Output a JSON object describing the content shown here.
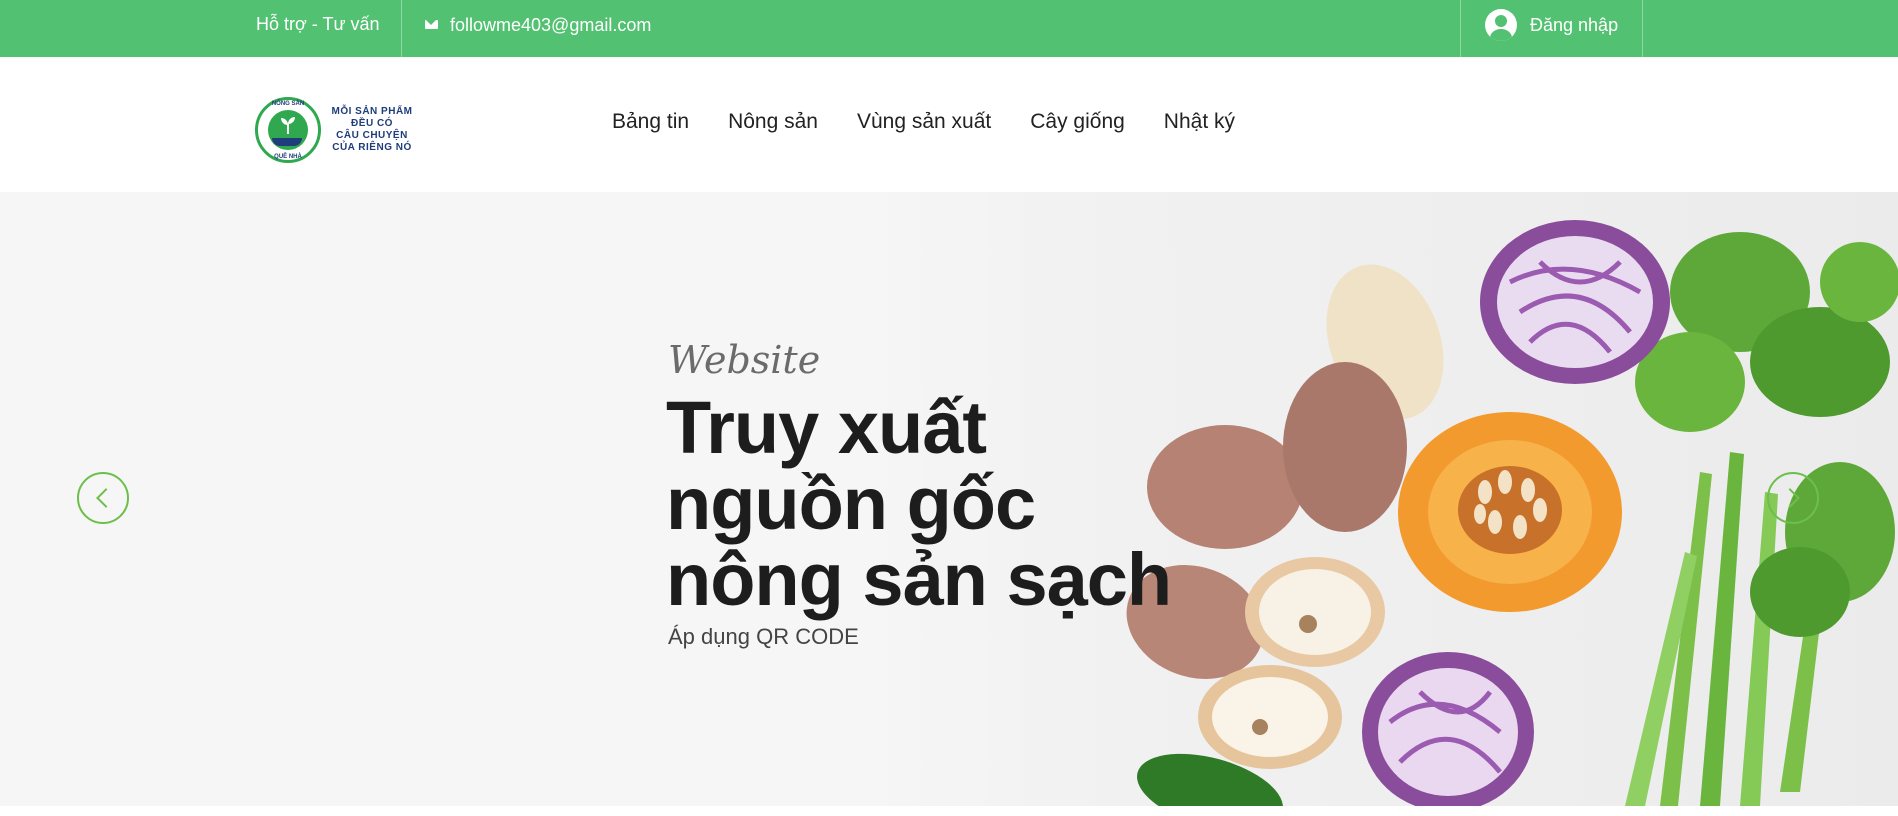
{
  "topbar": {
    "support": "Hỗ trợ - Tư vấn",
    "email": "followme403@gmail.com",
    "login": "Đăng nhập",
    "bg_color": "#53c172"
  },
  "logo": {
    "ring_top": "NÔNG SẢN",
    "ring_bottom": "QUÊ NHÀ",
    "slogan_line1": "MỖI SẢN PHẨM",
    "slogan_line2": "ĐỀU CÓ",
    "slogan_line3": "CÂU CHUYỆN",
    "slogan_line4": "CỦA RIÊNG NÓ"
  },
  "nav": {
    "items": [
      {
        "label": "Bảng tin"
      },
      {
        "label": "Nông sản"
      },
      {
        "label": "Vùng sản xuất"
      },
      {
        "label": "Cây giống"
      },
      {
        "label": "Nhật ký"
      }
    ]
  },
  "hero": {
    "kicker": "Website",
    "title_line1": "Truy xuất",
    "title_line2": "nguồn gốc",
    "title_line3": "nông sản sạch",
    "subtitle": "Áp dụng QR CODE",
    "accent_color": "#6cbf4b"
  },
  "icons": {
    "email": "envelope-icon",
    "login": "user-circle-icon",
    "prev": "chevron-left-icon",
    "next": "chevron-right-icon"
  }
}
